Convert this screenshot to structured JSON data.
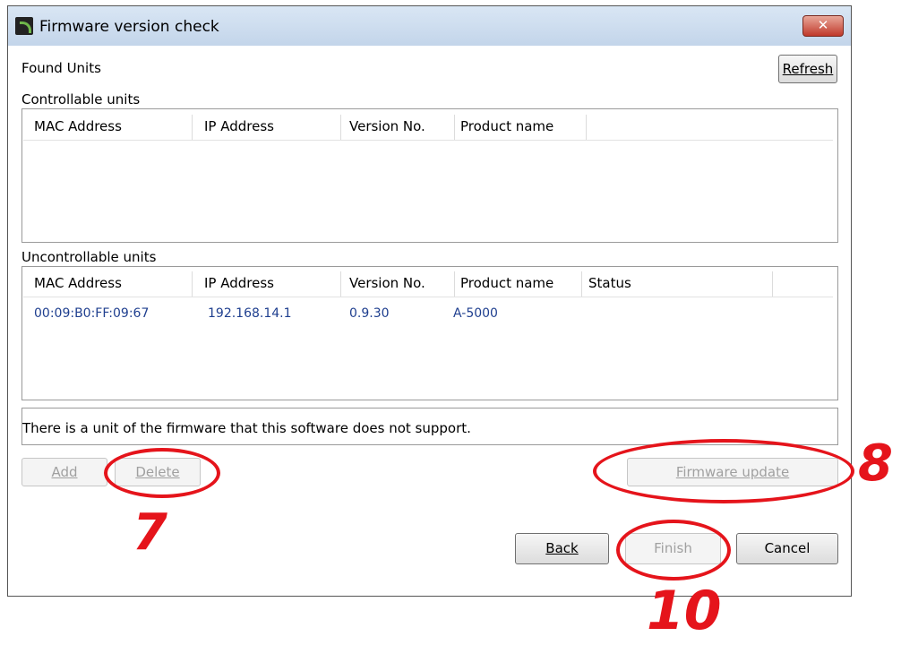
{
  "window": {
    "title": "Firmware version check",
    "close_glyph": "✕"
  },
  "found_units_label": "Found Units",
  "refresh_button": "Refresh",
  "controllable": {
    "label": "Controllable units",
    "columns": [
      "MAC Address",
      "IP Address",
      "Version No.",
      "Product name"
    ]
  },
  "uncontrollable": {
    "label": "Uncontrollable units",
    "columns": [
      "MAC Address",
      "IP Address",
      "Version No.",
      "Product name",
      "Status"
    ],
    "rows": [
      {
        "mac": "00:09:B0:FF:09:67",
        "ip": "192.168.14.1",
        "version": "0.9.30",
        "product": "A-5000",
        "status": ""
      }
    ]
  },
  "message": "There is a unit of the firmware that this software does not support.",
  "buttons": {
    "add": "Add",
    "delete": "Delete",
    "firmware_update": "Firmware update",
    "back": "Back",
    "finish": "Finish",
    "cancel": "Cancel"
  },
  "callouts": {
    "seven": "7",
    "eight": "8",
    "ten": "10",
    "color": "#e5141b"
  }
}
